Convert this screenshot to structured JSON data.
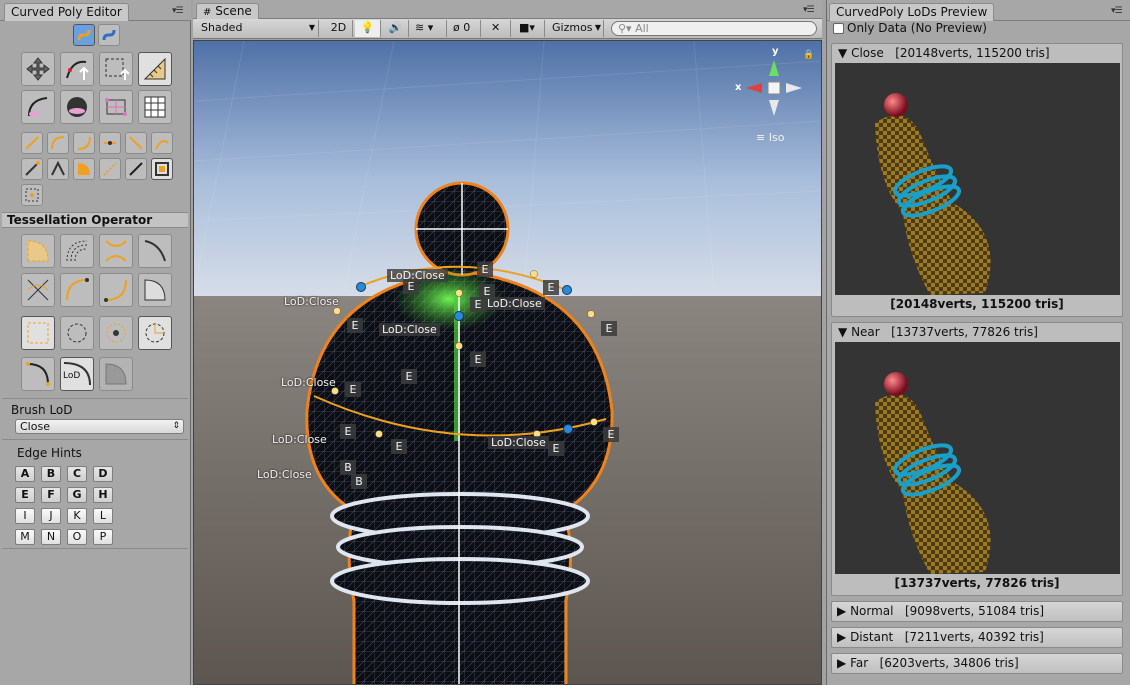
{
  "left_panel": {
    "tab_title": "Curved Poly Editor",
    "tessellation_heading": "Tessellation Operator",
    "lod_tool_text": "LoD",
    "brush_lod_label": "Brush LoD",
    "brush_lod_value": "Close",
    "edge_hints_label": "Edge Hints",
    "edge_hints": [
      "A",
      "B",
      "C",
      "D",
      "E",
      "F",
      "G",
      "H",
      "I",
      "J",
      "K",
      "L",
      "M",
      "N",
      "O",
      "P"
    ]
  },
  "scene": {
    "tab_title": "Scene",
    "shading_mode": "Shaded",
    "mode_2d": "2D",
    "hidden_count": "0",
    "gizmos_label": "Gizmos",
    "search_placeholder": "All",
    "gizmo": {
      "x": "x",
      "y": "y",
      "iso": "Iso"
    },
    "lod_labels": [
      "LoD:Close",
      "LoD:Close",
      "LoD:Close",
      "LoD:Close",
      "LoD:Close",
      "LoD:Close",
      "LoD:Close",
      "LoD:Close"
    ],
    "edge_tags": [
      "E",
      "E",
      "E",
      "E",
      "E",
      "E",
      "E",
      "E",
      "E",
      "E",
      "E",
      "E",
      "E",
      "E"
    ],
    "b_tags": [
      "B",
      "B"
    ]
  },
  "right_panel": {
    "tab_title": "CurvedPoly LoDs Preview",
    "only_data_label": "Only Data (No Preview)",
    "lods": [
      {
        "name": "Close",
        "stats": "[20148verts, 115200 tris]",
        "caption": "[20148verts, 115200 tris]",
        "expanded": true
      },
      {
        "name": "Near",
        "stats": "[13737verts, 77826 tris]",
        "caption": "[13737verts, 77826 tris]",
        "expanded": true
      },
      {
        "name": "Normal",
        "stats": "[9098verts, 51084 tris]",
        "expanded": false
      },
      {
        "name": "Distant",
        "stats": "[7211verts, 40392 tris]",
        "expanded": false
      },
      {
        "name": "Far",
        "stats": "[6203verts, 34806 tris]",
        "expanded": false
      }
    ]
  },
  "colors": {
    "accent_orange": "#f0a020",
    "selection_blue": "#2a8ad8",
    "green_highlight": "#4ccf3a"
  }
}
